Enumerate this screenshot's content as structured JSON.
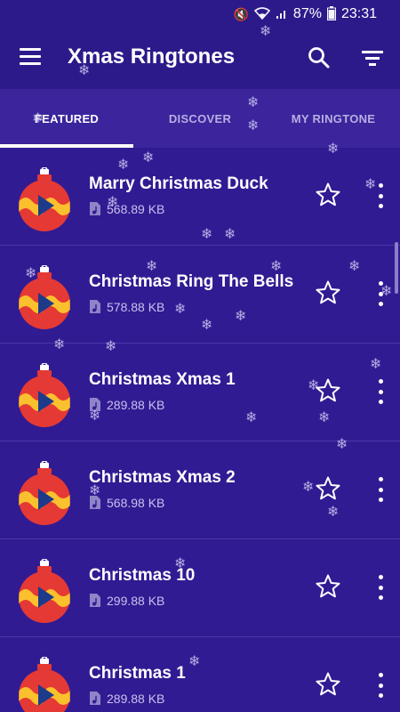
{
  "status": {
    "battery": "87%",
    "time": "23:31"
  },
  "app": {
    "title": "Xmas Ringtones"
  },
  "tabs": [
    {
      "label": "FEATURED",
      "active": true
    },
    {
      "label": "DISCOVER",
      "active": false
    },
    {
      "label": "MY RINGTONE",
      "active": false
    }
  ],
  "ringtones": [
    {
      "name": "Marry Christmas Duck",
      "size": "568.89 KB"
    },
    {
      "name": "Christmas Ring The Bells",
      "size": "578.88 KB"
    },
    {
      "name": "Christmas Xmas 1",
      "size": "289.88 KB"
    },
    {
      "name": "Christmas Xmas 2",
      "size": "568.98 KB"
    },
    {
      "name": "Christmas 10",
      "size": "299.88 KB"
    },
    {
      "name": "Christmas 1",
      "size": "289.88 KB"
    }
  ],
  "colors": {
    "background": "#311b92",
    "appbar": "#2c1a8a",
    "ornament_red": "#e53935",
    "ornament_yellow": "#fbc02d",
    "play_blue": "#1e3a8a"
  },
  "icons": {
    "menu": "menu-icon",
    "search": "search-icon",
    "filter": "filter-icon",
    "star": "star-outline-icon",
    "more": "more-vertical-icon",
    "file": "music-file-icon",
    "ornament": "christmas-ornament-play-icon",
    "flake": "snowflake-icon"
  }
}
